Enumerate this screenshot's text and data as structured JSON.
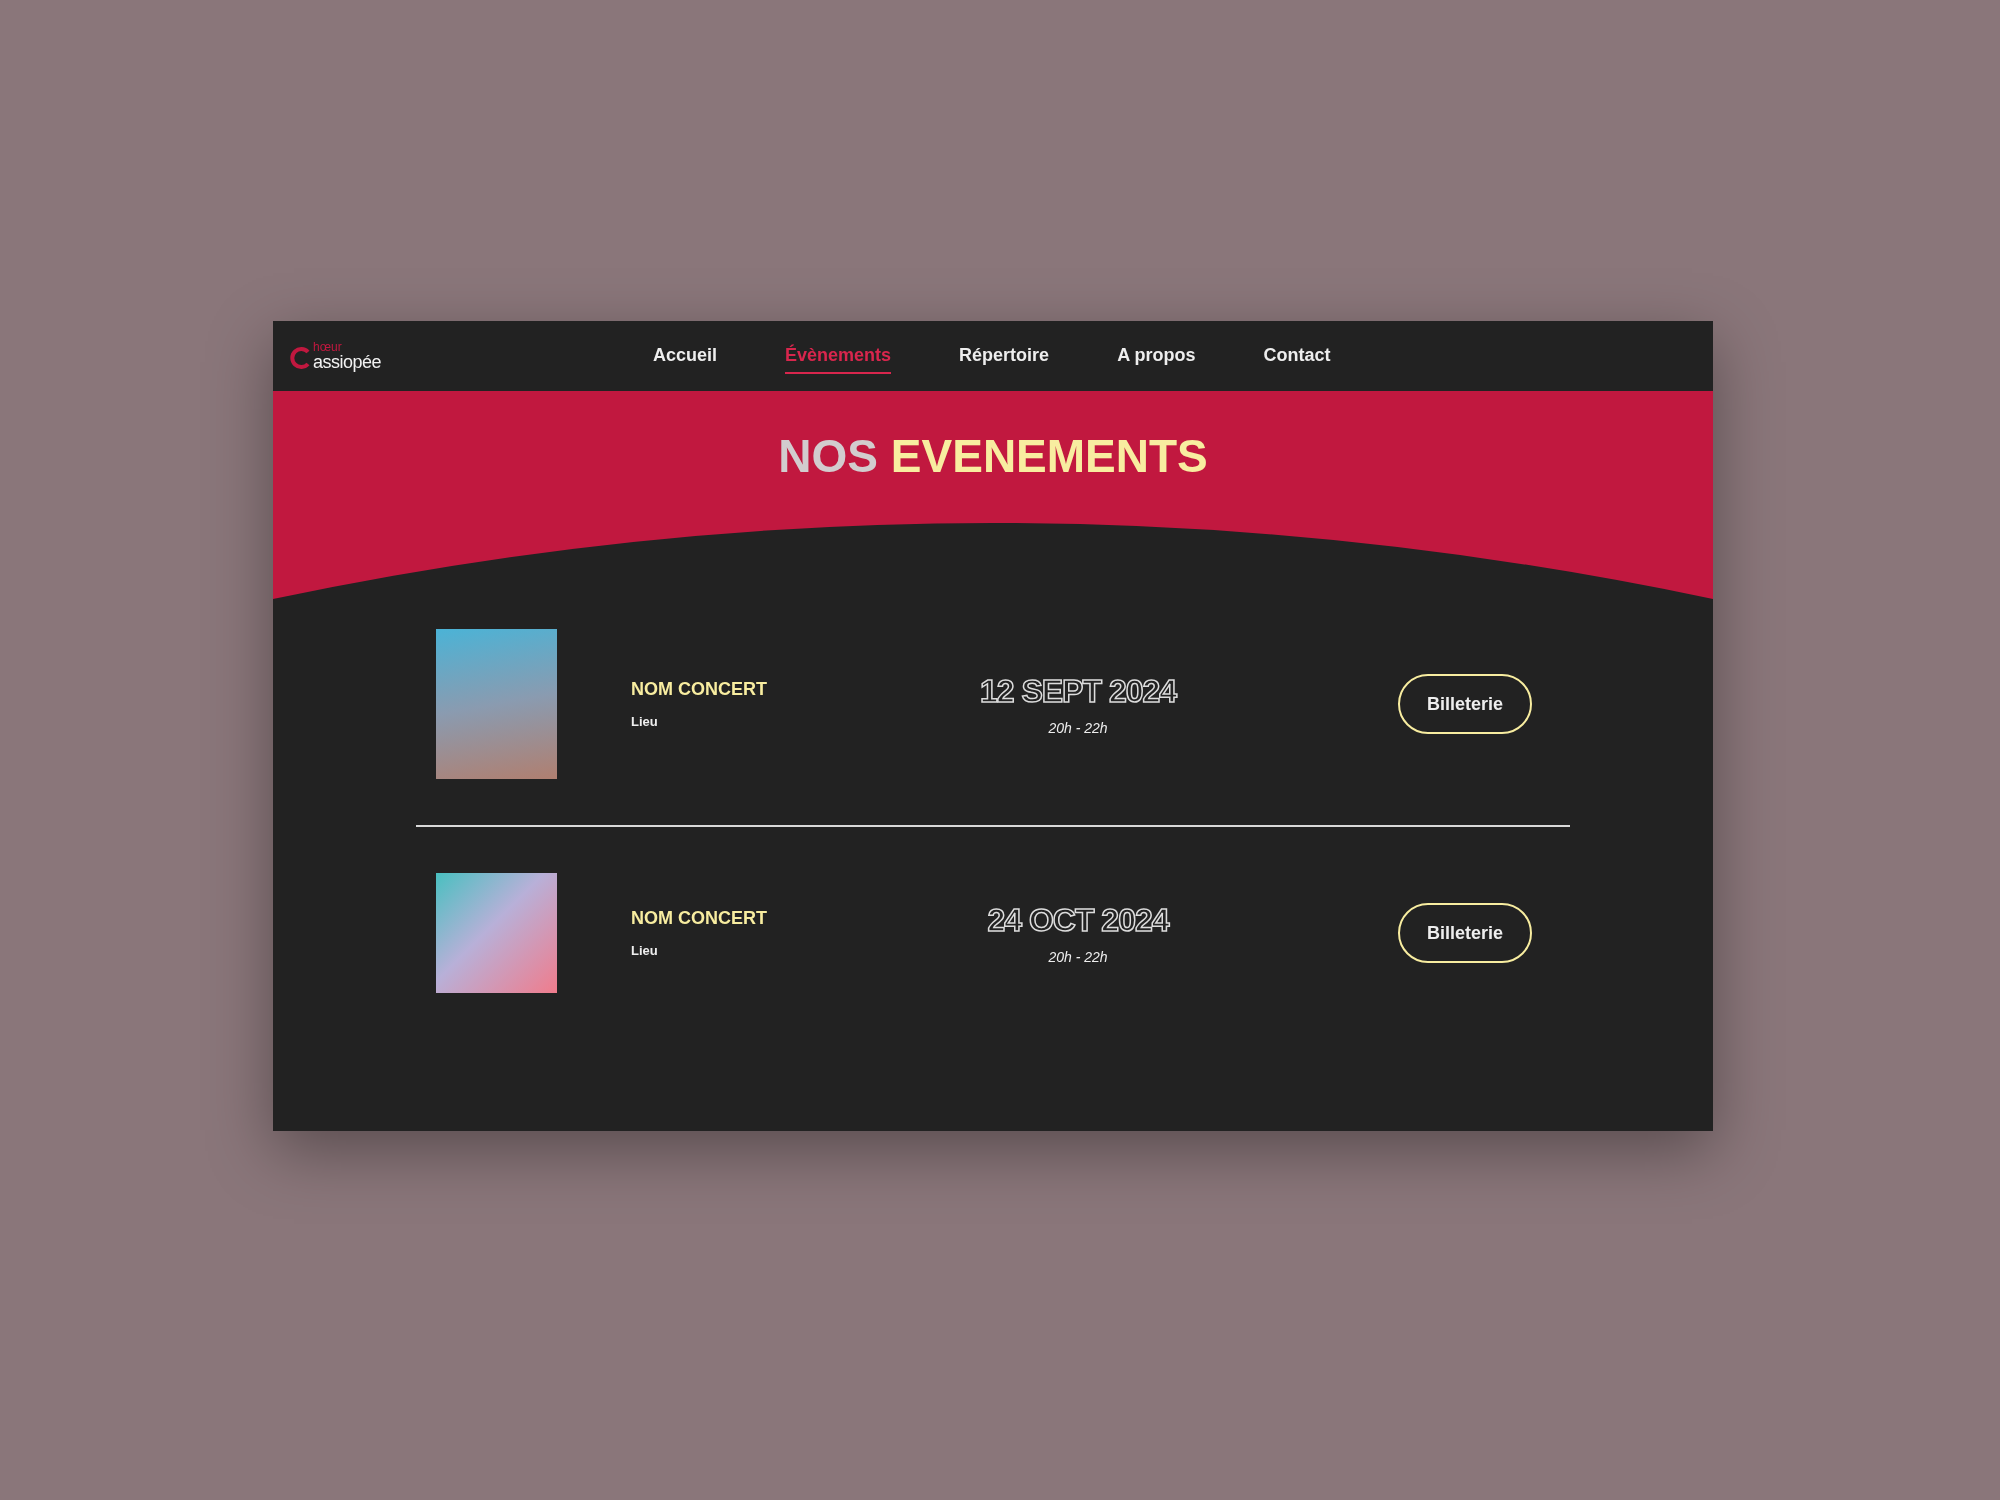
{
  "logo": {
    "top": "hœur",
    "bottom": "assiopée"
  },
  "nav": [
    {
      "label": "Accueil",
      "selected": false
    },
    {
      "label": "Évènements",
      "selected": true
    },
    {
      "label": "Répertoire",
      "selected": false
    },
    {
      "label": "A propos",
      "selected": false
    },
    {
      "label": "Contact",
      "selected": false
    }
  ],
  "heading": {
    "muted": "NOS",
    "highlight": "EVENEMENTS"
  },
  "events": [
    {
      "kind": "portrait",
      "name": "NOM CONCERT",
      "place": "Lieu",
      "date": "12 SEPT 2024",
      "time": "20h - 22h",
      "button": "Billeterie"
    },
    {
      "kind": "square",
      "name": "NOM CONCERT",
      "place": "Lieu",
      "date": "24 OCT 2024",
      "time": "20h - 22h",
      "button": "Billeterie"
    }
  ]
}
